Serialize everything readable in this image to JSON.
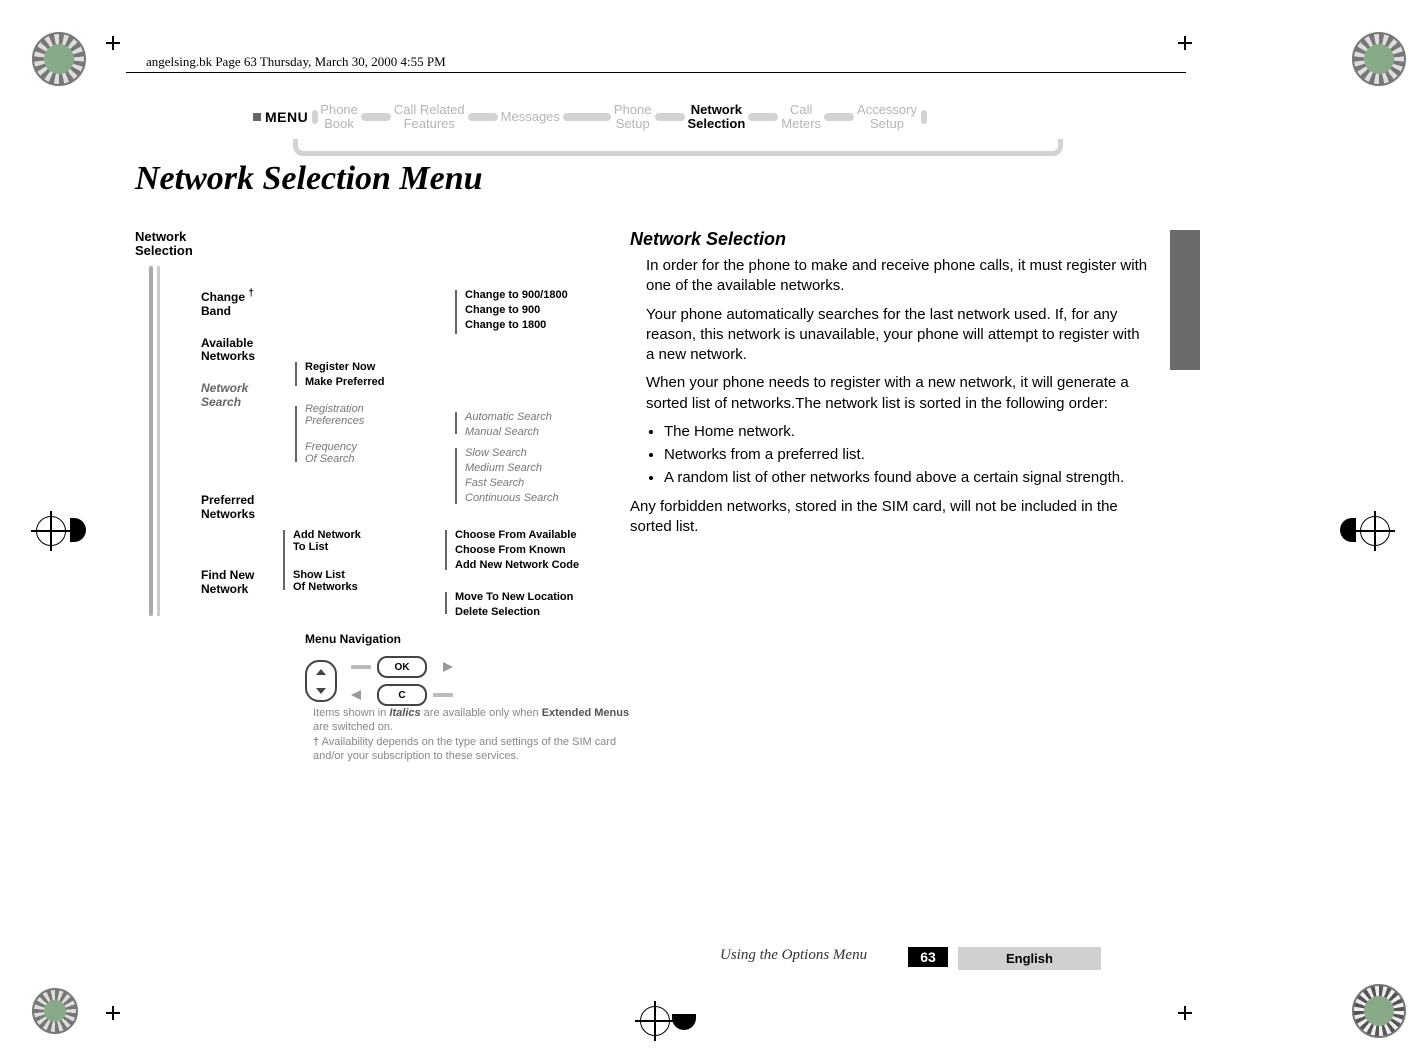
{
  "header": {
    "running_head": "angelsing.bk  Page 63  Thursday, March 30, 2000  4:55 PM"
  },
  "menubar": {
    "label": "MENU",
    "items": [
      {
        "l1": "Phone",
        "l2": "Book"
      },
      {
        "l1": "Call Related",
        "l2": "Features"
      },
      {
        "l1": "Messages",
        "l2": ""
      },
      {
        "l1": "Phone",
        "l2": "Setup"
      },
      {
        "l1": "Network",
        "l2": "Selection",
        "active": true
      },
      {
        "l1": "Call",
        "l2": "Meters"
      },
      {
        "l1": "Accessory",
        "l2": "Setup"
      }
    ]
  },
  "title": "Network Selection Menu",
  "diagram": {
    "root_l1": "Network",
    "root_l2": "Selection",
    "changeband_l1": "Change",
    "changeband_l2": "Band",
    "cb_opts": [
      "Change to 900/1800",
      "Change to 900",
      "Change to 1800"
    ],
    "availnet_l1": "Available",
    "availnet_l2": "Networks",
    "an_opts": [
      "Register Now",
      "Make Preferred"
    ],
    "netsearch_l1": "Network",
    "netsearch_l2": "Search",
    "ns_regpref": "Registration\nPreferences",
    "ns_regpref_l1": "Registration",
    "ns_regpref_l2": "Preferences",
    "ns_regpref_opts": [
      "Automatic Search",
      "Manual Search"
    ],
    "ns_freq_l1": "Frequency",
    "ns_freq_l2": "Of Search",
    "ns_freq_opts": [
      "Slow Search",
      "Medium Search",
      "Fast Search",
      "Continuous Search"
    ],
    "prefnet_l1": "Preferred",
    "prefnet_l2": "Networks",
    "pn_add_l1": "Add Network",
    "pn_add_l2": "To List",
    "pn_add_opts": [
      "Choose From Available",
      "Choose From Known",
      "Add New Network Code"
    ],
    "pn_show_l1": "Show List",
    "pn_show_l2": "Of Networks",
    "pn_show_opts": [
      "Move To New Location",
      "Delete Selection"
    ],
    "findnew_l1": "Find New",
    "findnew_l2": "Network",
    "nav_label": "Menu Navigation",
    "ok_label": "OK",
    "c_label": "C",
    "footnote_1a": "Items shown in ",
    "footnote_1b": "Italics",
    "footnote_1c": " are available only when ",
    "footnote_1d": "Extended Menus",
    "footnote_1e": " are switched on.",
    "footnote_2": "Availability depends on the type and settings of the SIM card and/or your subscription to these services.",
    "dagger": "†"
  },
  "body": {
    "heading": "Network Selection",
    "p1": "In order for the phone to make and receive phone calls, it must register with one of the available networks.",
    "p2": "Your phone automatically searches for the last network used. If, for any reason, this network is unavailable, your phone will attempt to register with a new network.",
    "p3": "When your phone needs to register with a new network, it will generate a sorted list of networks.The network list is sorted in the following order:",
    "b1": "The Home network.",
    "b2": "Networks from a preferred list.",
    "b3": "A random list of other networks found above a certain signal strength.",
    "p4": "Any forbidden networks, stored in the SIM card, will not be included in the sorted list."
  },
  "footer": {
    "section": "Using the Options Menu",
    "page": "63",
    "language": "English"
  }
}
